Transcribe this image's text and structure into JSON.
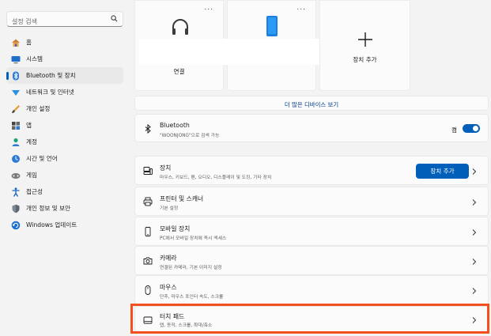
{
  "search": {
    "placeholder": "설정 검색"
  },
  "sidebar": {
    "items": [
      {
        "label": "홈",
        "icon": "home-icon"
      },
      {
        "label": "시스템",
        "icon": "system-icon"
      },
      {
        "label": "Bluetooth 및 장치",
        "icon": "bluetooth-icon",
        "active": true
      },
      {
        "label": "네트워크 및 인터넷",
        "icon": "network-icon"
      },
      {
        "label": "개인 설정",
        "icon": "personalization-icon"
      },
      {
        "label": "앱",
        "icon": "apps-icon"
      },
      {
        "label": "계정",
        "icon": "accounts-icon"
      },
      {
        "label": "시간 및 언어",
        "icon": "time-language-icon"
      },
      {
        "label": "게임",
        "icon": "gaming-icon"
      },
      {
        "label": "접근성",
        "icon": "accessibility-icon"
      },
      {
        "label": "개인 정보 및 보안",
        "icon": "privacy-security-icon"
      },
      {
        "label": "Windows 업데이트",
        "icon": "windows-update-icon"
      }
    ]
  },
  "tiles": {
    "headphone_caption": "연결",
    "add_device_label": "장치 추가",
    "more_glyph": "..."
  },
  "more_devices": {
    "label": "더 많은 디바이스 보기"
  },
  "bluetooth": {
    "title": "Bluetooth",
    "subtitle": "\"WOONJONG\"으로 검색 가능",
    "toggle_label": "켬",
    "on": true
  },
  "rows": {
    "devices": {
      "title": "장치",
      "subtitle": "마우스, 키보드, 펜, 오디오, 디스플레이 및 도킹, 기타 장치",
      "button": "장치 추가"
    },
    "printers": {
      "title": "프린터 및 스캐너",
      "subtitle": "기본 설정"
    },
    "mobile": {
      "title": "모바일 장치",
      "subtitle": "PC에서 모바일 장치에 즉시 액세스"
    },
    "camera": {
      "title": "카메라",
      "subtitle": "연결된 카메라, 기본 이미지 설정"
    },
    "mouse": {
      "title": "마우스",
      "subtitle": "단추, 마우스 포인터 속도, 스크롤"
    },
    "touchpad": {
      "title": "터치 패드",
      "subtitle": "탭, 동작, 스크롤, 확대/축소"
    }
  },
  "colors": {
    "accent": "#005fb8",
    "highlight": "#f4501e",
    "background": "#f3f3f3"
  }
}
